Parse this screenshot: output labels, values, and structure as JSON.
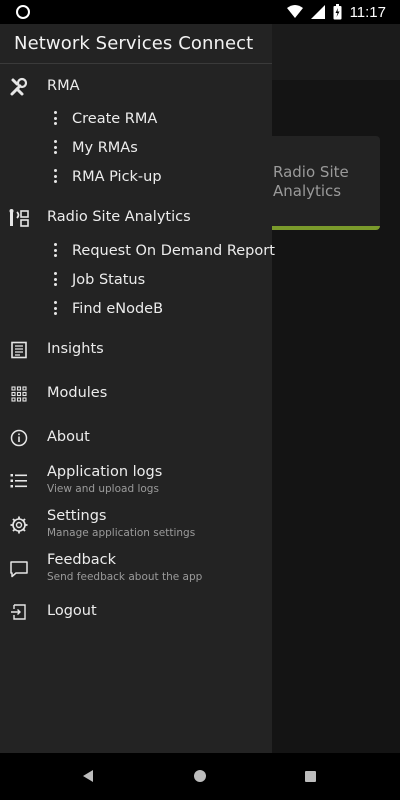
{
  "status_bar": {
    "time": "11:17"
  },
  "drawer": {
    "title": "Network Services Connect",
    "sections": [
      {
        "label": "RMA",
        "icon": "tools-icon",
        "subitems": [
          "Create RMA",
          "My RMAs",
          "RMA Pick-up"
        ]
      },
      {
        "label": "Radio Site Analytics",
        "icon": "radio-site-icon",
        "subitems": [
          "Request On Demand Report",
          "Job Status",
          "Find eNodeB"
        ]
      }
    ],
    "items": [
      {
        "label": "Insights",
        "icon": "insights-icon"
      },
      {
        "label": "Modules",
        "icon": "modules-grid-icon"
      },
      {
        "label": "About",
        "icon": "info-icon"
      },
      {
        "label": "Application logs",
        "sub": "View and upload logs",
        "icon": "list-icon"
      },
      {
        "label": "Settings",
        "sub": "Manage application settings",
        "icon": "gear-icon"
      },
      {
        "label": "Feedback",
        "sub": "Send feedback about the app",
        "icon": "chat-icon"
      },
      {
        "label": "Logout",
        "icon": "logout-icon"
      }
    ]
  },
  "background": {
    "card_label": "Radio Site Analytics",
    "card_accent": "#7a9a2b"
  }
}
